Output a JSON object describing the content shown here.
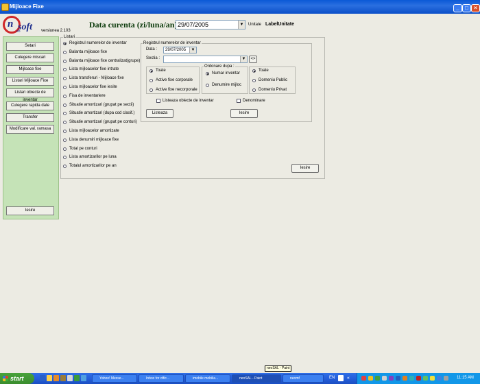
{
  "window": {
    "title": "Mijloace Fixe"
  },
  "header": {
    "logo_main": "soft",
    "logo_letter": "n",
    "logo_sub": "eo",
    "version": "versiunea 2.103",
    "date_label": "Data curenta (zi/luna/an):",
    "date_value": "29/07/2005",
    "unitate_label": "Unitate",
    "unitate_value": "LabelUnitate"
  },
  "sidebar": {
    "buttons": [
      "Setari",
      "Culegere miscari",
      "Mijloace fixe",
      "Listari Mijloace Fixe",
      "Listari obiecte de inventar",
      "Culegere rapida date",
      "Transfer",
      "Modificare val. ramasa"
    ],
    "exit": "Iesire"
  },
  "listari": {
    "label": "Listari",
    "items": [
      "Registrul numerelor de inventar",
      "Balanta mijloace fixe",
      "Balanta mijloace fixe centralizat(grupe)",
      "Lista mijloacelor fixe intrate",
      "Lista transferuri - Mijloace fixe",
      "Lista mijloacelor fixe iesite",
      "Fisa de inventariere",
      "Situatie amortizari (grupat pe sectii)",
      "Situatie amortizari (dupa cod clasif.)",
      "Situatie amortizari (grupat pe conturi)",
      "Lista mijloacelor amortizate",
      "Lista denumiri mijloace fixe",
      "Total pe conturi",
      "Lista amortizarilor pe luna",
      "Totalul amortizarilor pe an"
    ],
    "selected_index": 0
  },
  "registru": {
    "label": "Registrul numerelor de inventar",
    "data_label": "Data :",
    "data_value": "29/07/2005",
    "sectia_label": "Sectia :",
    "sectia_value": "",
    "browse_label": "<>",
    "group1": {
      "items": [
        "Toate",
        "Active fixe corporale",
        "Active fixe necorporale"
      ],
      "selected": 0
    },
    "ordonare": {
      "label": "Ordonare dupa :",
      "items": [
        "Numar inventar",
        "Denumire mijloc"
      ],
      "selected": 0
    },
    "group3": {
      "items": [
        "Toate",
        "Domeniu Public",
        "Domeniu Privat"
      ],
      "selected": 0
    },
    "check_obiecte": "Listeaza obiecte de inventar",
    "check_denominare": "Denominare",
    "listeaza": "Listeaza",
    "iesire": "Iesire"
  },
  "panel_exit": "Iesire",
  "taskbar": {
    "start": "start",
    "items": [
      "Yahoo! Messe...",
      "Inbox for offic...",
      "imobile mobilia...",
      "neoSAL - Paint",
      "neomf"
    ],
    "active_index": 3,
    "lang": "EN",
    "clock": "11:15 AM",
    "tooltip": "neoSAL - Paint"
  },
  "colors": {
    "title_bar": "#0a59d6",
    "sidebar_bg": "#c5e3b7",
    "date_label": "#0b3a0b",
    "taskbar": "#245edb",
    "start": "#3a8d2e"
  }
}
